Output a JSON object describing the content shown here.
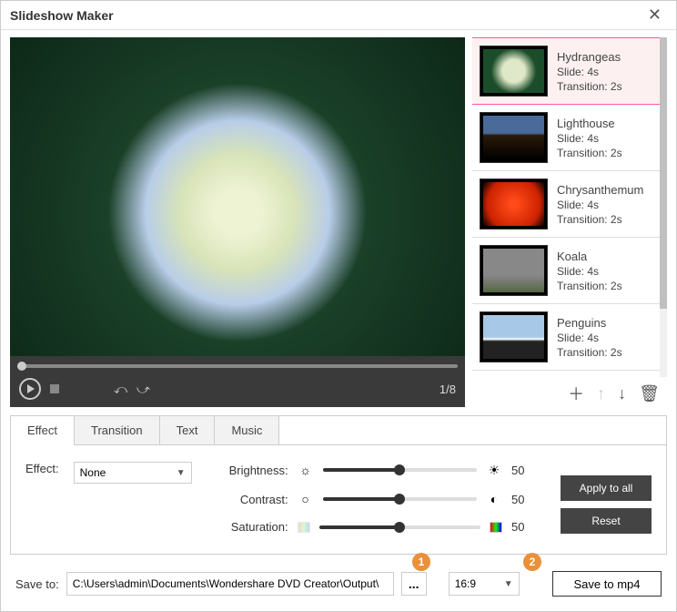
{
  "window": {
    "title": "Slideshow Maker"
  },
  "preview": {
    "counter": "1/8"
  },
  "slides": [
    {
      "name": "Hydrangeas",
      "slide": "Slide: 4s",
      "transition": "Transition: 2s",
      "thumb": "th-hyd",
      "selected": true
    },
    {
      "name": "Lighthouse",
      "slide": "Slide: 4s",
      "transition": "Transition: 2s",
      "thumb": "th-light",
      "selected": false
    },
    {
      "name": "Chrysanthemum",
      "slide": "Slide: 4s",
      "transition": "Transition: 2s",
      "thumb": "th-chrys",
      "selected": false
    },
    {
      "name": "Koala",
      "slide": "Slide: 4s",
      "transition": "Transition: 2s",
      "thumb": "th-koala",
      "selected": false
    },
    {
      "name": "Penguins",
      "slide": "Slide: 4s",
      "transition": "Transition: 2s",
      "thumb": "th-peng",
      "selected": false
    }
  ],
  "tabs": {
    "effect": "Effect",
    "transition": "Transition",
    "text": "Text",
    "music": "Music"
  },
  "effect": {
    "label": "Effect:",
    "dropdown": "None",
    "brightness_lbl": "Brightness:",
    "contrast_lbl": "Contrast:",
    "saturation_lbl": "Saturation:",
    "val50": "50",
    "apply_all": "Apply to all",
    "reset": "Reset"
  },
  "save": {
    "label": "Save to:",
    "path": "C:\\Users\\admin\\Documents\\Wondershare DVD Creator\\Output\\",
    "browse": "...",
    "aspect": "16:9",
    "button": "Save to mp4"
  },
  "markers": {
    "m1": "1",
    "m2": "2"
  }
}
